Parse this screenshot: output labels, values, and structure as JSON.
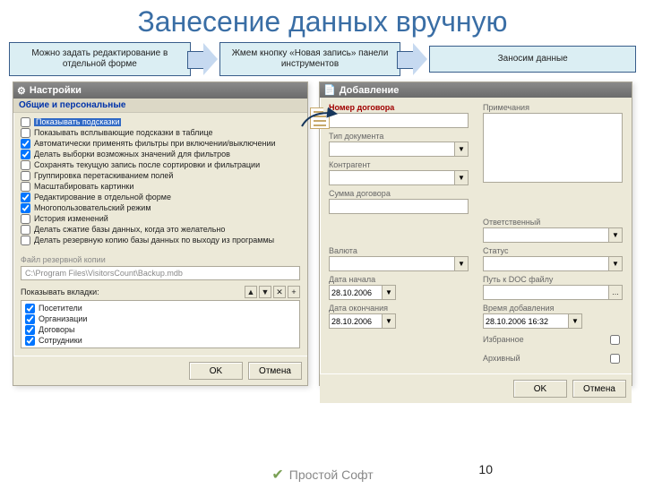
{
  "title": "Занесение данных вручную",
  "stages": [
    "Можно задать редактирование в отдельной форме",
    "Жмем кнопку «Новая запись» панели инструментов",
    "Заносим данные"
  ],
  "settings": {
    "title": "Настройки",
    "section": "Общие и персональные",
    "checks": [
      {
        "checked": false,
        "label": "Показывать подсказки",
        "highlight": true
      },
      {
        "checked": false,
        "label": "Показывать всплывающие подсказки в таблице"
      },
      {
        "checked": true,
        "label": "Автоматически применять фильтры при включении/выключении"
      },
      {
        "checked": true,
        "label": "Делать выборки возможных значений для фильтров"
      },
      {
        "checked": false,
        "label": "Сохранять текущую запись после сортировки и фильтрации"
      },
      {
        "checked": false,
        "label": "Группировка перетаскиванием полей"
      },
      {
        "checked": false,
        "label": "Масштабировать картинки"
      },
      {
        "checked": true,
        "label": "Редактирование в отдельной форме"
      },
      {
        "checked": true,
        "label": "Многопользовательский режим"
      },
      {
        "checked": false,
        "label": "История изменений"
      },
      {
        "checked": false,
        "label": "Делать сжатие базы данных, когда это желательно"
      },
      {
        "checked": false,
        "label": "Делать резервную копию базы данных по выходу из программы"
      }
    ],
    "backup_label": "Файл резервной копии",
    "backup_path": "C:\\Program Files\\VisitorsCount\\Backup.mdb",
    "tabs_label": "Показывать вкладки:",
    "tabs": [
      {
        "checked": true,
        "label": "Посетители"
      },
      {
        "checked": true,
        "label": "Организации"
      },
      {
        "checked": true,
        "label": "Договоры"
      },
      {
        "checked": true,
        "label": "Сотрудники"
      }
    ],
    "ok": "OK",
    "cancel": "Отмена"
  },
  "add": {
    "title": "Добавление",
    "fields": {
      "doc_number": "Номер договора",
      "doc_type": "Тип документа",
      "counterparty": "Контрагент",
      "amount": "Сумма договора",
      "currency": "Валюта",
      "date_start": "Дата начала",
      "date_end": "Дата окончания",
      "notes": "Примечания",
      "responsible": "Ответственный",
      "status": "Статус",
      "doc_path": "Путь к DOC файлу",
      "added_time": "Время добавления",
      "favorite": "Избранное",
      "archived": "Архивный"
    },
    "values": {
      "date_start": "28.10.2006",
      "date_end": "28.10.2006",
      "added_time": "28.10.2006 16:32"
    },
    "ok": "OK",
    "cancel": "Отмена"
  },
  "footer_brand": "Простой Софт",
  "page": "10"
}
